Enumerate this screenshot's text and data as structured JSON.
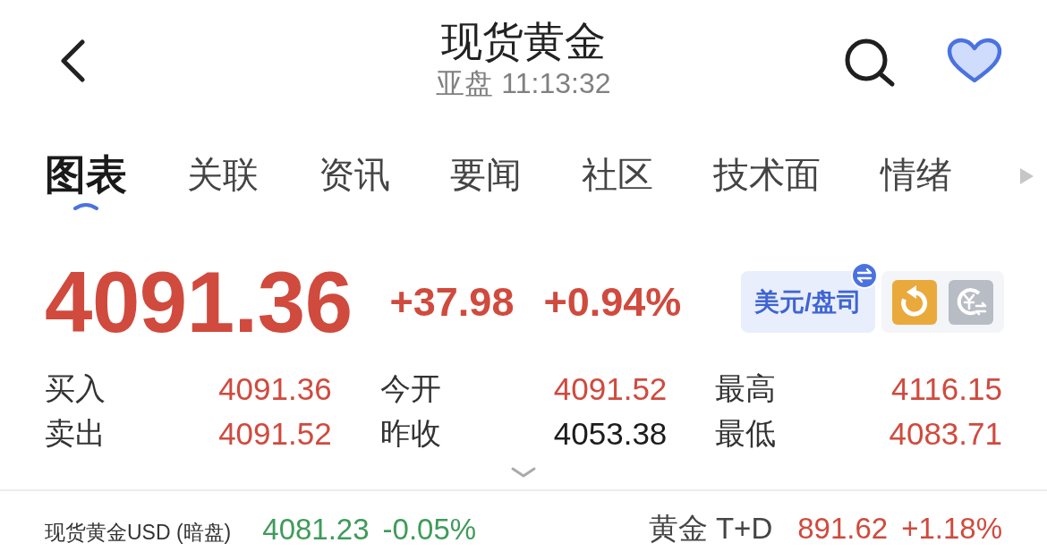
{
  "header": {
    "title": "现货黄金",
    "subtitle": "亚盘 11:13:32",
    "favorited": true
  },
  "tabs": [
    {
      "label": "图表",
      "selected": true
    },
    {
      "label": "关联",
      "selected": false
    },
    {
      "label": "资讯",
      "selected": false
    },
    {
      "label": "要闻",
      "selected": false
    },
    {
      "label": "社区",
      "selected": false
    },
    {
      "label": "技术面",
      "selected": false
    },
    {
      "label": "情绪",
      "selected": false
    }
  ],
  "quote": {
    "price": "4091.36",
    "change": "+37.98",
    "change_percent": "+0.94%",
    "color": "#d04a3e",
    "unit_button": "美元/盘司"
  },
  "stats": [
    {
      "label": "买入",
      "value": "4091.36",
      "color": "#d04a3e"
    },
    {
      "label": "今开",
      "value": "4091.52",
      "color": "#d04a3e"
    },
    {
      "label": "最高",
      "value": "4116.15",
      "color": "#d04a3e"
    },
    {
      "label": "卖出",
      "value": "4091.52",
      "color": "#d04a3e"
    },
    {
      "label": "昨收",
      "value": "4053.38",
      "color": "#1c1c1c"
    },
    {
      "label": "最低",
      "value": "4083.71",
      "color": "#d04a3e"
    }
  ],
  "related": [
    {
      "name": "现货黄金USD (暗盘)",
      "price": "4081.23",
      "change": "-0.05%",
      "color": "#3f9b5a"
    },
    {
      "name": "黄金 T+D",
      "price": "891.62",
      "change": "+1.18%",
      "color": "#d04a3e"
    }
  ]
}
